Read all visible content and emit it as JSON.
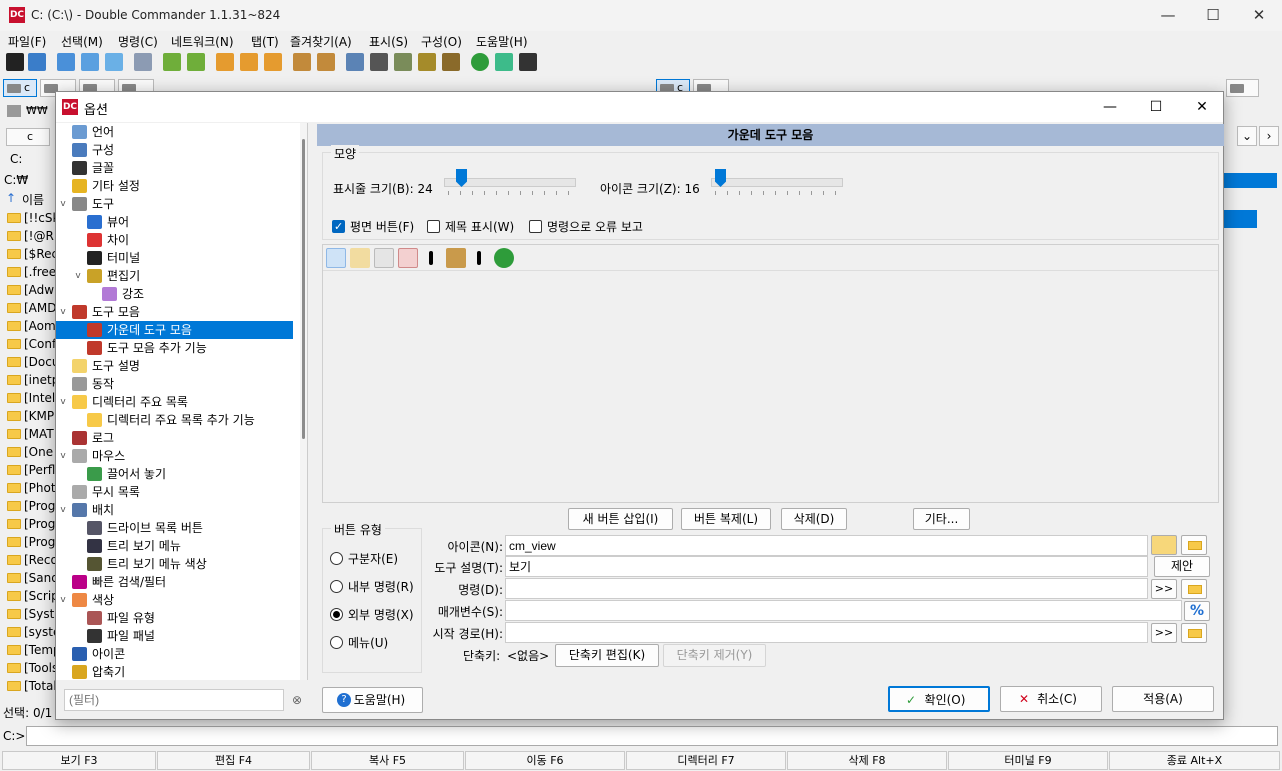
{
  "window": {
    "title": "C: (C:\\) - Double Commander 1.1.31~824",
    "logo": "DC"
  },
  "menu": [
    "파일(F)",
    "선택(M)",
    "명령(C)",
    "네트워크(N)",
    "탭(T)",
    "즐겨찾기(A)",
    "표시(S)",
    "구성(O)",
    "도움말(H)"
  ],
  "background": {
    "left_drive": "c",
    "right_drive": "c",
    "left_tab": "₩₩",
    "left_path_drive": "c",
    "path": "C:",
    "path2": "C:₩",
    "name_header": "이름",
    "rows": [
      "[!!cSk",
      "[!@R",
      "[$Rec",
      "[.free",
      "[Adw",
      "[AMD",
      "[Aom",
      "[Conf",
      "[Docu",
      "[inetp",
      "[Intel]",
      "[KMP",
      "[MAT",
      "[One",
      "[Perfl",
      "[Phot",
      "[Prog",
      "[Prog",
      "[Prog",
      "[Reco",
      "[Sand",
      "[Scrip",
      "[Syste",
      "[syste",
      "[Temp",
      "[Tools",
      "[Total"
    ],
    "selection_status": "선택: 0/1",
    "cmd_label": "C:>"
  },
  "fkeys": [
    "보기 F3",
    "편집 F4",
    "복사 F5",
    "이동 F6",
    "디렉터리 F7",
    "삭제 F8",
    "터미널 F9",
    "종료 Alt+X"
  ],
  "dialog": {
    "title": "옵션",
    "tree": [
      {
        "label": "언어",
        "level": 0,
        "icon": "language-icon"
      },
      {
        "label": "구성",
        "level": 0,
        "icon": "layout-icon"
      },
      {
        "label": "글꼴",
        "level": 0,
        "icon": "font-icon"
      },
      {
        "label": "기타 설정",
        "level": 0,
        "icon": "misc-icon"
      },
      {
        "label": "도구",
        "level": 0,
        "icon": "tools-icon",
        "expanded": true
      },
      {
        "label": "뷰어",
        "level": 1,
        "icon": "viewer-icon"
      },
      {
        "label": "차이",
        "level": 1,
        "icon": "diff-icon"
      },
      {
        "label": "터미널",
        "level": 1,
        "icon": "terminal-icon"
      },
      {
        "label": "편집기",
        "level": 1,
        "icon": "editor-icon",
        "expanded": true
      },
      {
        "label": "강조",
        "level": 2,
        "icon": "highlight-icon"
      },
      {
        "label": "도구 모음",
        "level": 0,
        "icon": "toolbar-icon",
        "expanded": true
      },
      {
        "label": "가운데 도구 모음",
        "level": 1,
        "icon": "toolbar-middle-icon",
        "selected": true
      },
      {
        "label": "도구 모음 추가 기능",
        "level": 1,
        "icon": "toolbar-extra-icon"
      },
      {
        "label": "도구 설명",
        "level": 0,
        "icon": "tooltip-icon"
      },
      {
        "label": "동작",
        "level": 0,
        "icon": "behavior-icon"
      },
      {
        "label": "디렉터리 주요 목록",
        "level": 0,
        "icon": "hotlist-icon",
        "expanded": true
      },
      {
        "label": "디렉터리 주요 목록 추가 기능",
        "level": 1,
        "icon": "hotlist-extra-icon"
      },
      {
        "label": "로그",
        "level": 0,
        "icon": "log-icon"
      },
      {
        "label": "마우스",
        "level": 0,
        "icon": "mouse-icon",
        "expanded": true
      },
      {
        "label": "끌어서 놓기",
        "level": 1,
        "icon": "drag-drop-icon"
      },
      {
        "label": "무시 목록",
        "level": 0,
        "icon": "ignore-list-icon"
      },
      {
        "label": "배치",
        "level": 0,
        "icon": "layout-arrange-icon",
        "expanded": true
      },
      {
        "label": "드라이브 목록 버튼",
        "level": 1,
        "icon": "drive-list-icon"
      },
      {
        "label": "트리 보기 메뉴",
        "level": 1,
        "icon": "tree-menu-icon"
      },
      {
        "label": "트리 보기 메뉴 색상",
        "level": 1,
        "icon": "tree-menu-color-icon"
      },
      {
        "label": "빠른 검색/필터",
        "level": 0,
        "icon": "quick-search-icon"
      },
      {
        "label": "색상",
        "level": 0,
        "icon": "color-wheel-icon",
        "expanded": true
      },
      {
        "label": "파일 유형",
        "level": 1,
        "icon": "file-types-icon"
      },
      {
        "label": "파일 패널",
        "level": 1,
        "icon": "file-panel-icon"
      },
      {
        "label": "아이콘",
        "level": 0,
        "icon": "icons-icon"
      },
      {
        "label": "압축기",
        "level": 0,
        "icon": "archiver-icon"
      }
    ],
    "filter_placeholder": "(필터)",
    "help_button": "도움말(H)",
    "ok_button": "확인(O)",
    "cancel_button": "취소(C)",
    "apply_button": "적용(A)",
    "panel": {
      "header": "가운데 도구 모음",
      "shape_group": "모양",
      "bar_size_label": "표시줄 크기(B): 24",
      "icon_size_label": "아이콘 크기(Z): 16",
      "bar_size_level": 0.08,
      "icon_size_level": 0.03,
      "flat_buttons": "평면 버튼(F)",
      "flat_buttons_checked": true,
      "show_caption": "제목 표시(W)",
      "show_caption_checked": false,
      "report_errors": "명령으로 오류 보고",
      "report_errors_checked": false,
      "insert_button": "새 버튼 삽입(I)",
      "clone_button": "버튼 복제(L)",
      "delete_button": "삭제(D)",
      "other_button": "기타...",
      "button_type_group": "버튼 유형",
      "type_separator": "구분자(E)",
      "type_internal": "내부 명령(R)",
      "type_external": "외부 명령(X)",
      "type_menu": "메뉴(U)",
      "selected_type": "external",
      "icon_label": "아이콘(N):",
      "icon_value": "cm_view",
      "tooltip_label": "도구 설명(T):",
      "tooltip_value": "보기",
      "suggest_button": "제안",
      "command_label": "명령(D):",
      "command_value": "",
      "params_label": "매개변수(S):",
      "params_value": "",
      "start_path_label": "시작 경로(H):",
      "start_path_value": "",
      "hotkey_label": "단축키:",
      "hotkey_value": "<없음>",
      "edit_hotkey_button": "단축키 편집(K)",
      "remove_hotkey_button": "단축키 제거(Y)",
      "more_glyph": ">>",
      "percent_glyph": "%"
    }
  }
}
